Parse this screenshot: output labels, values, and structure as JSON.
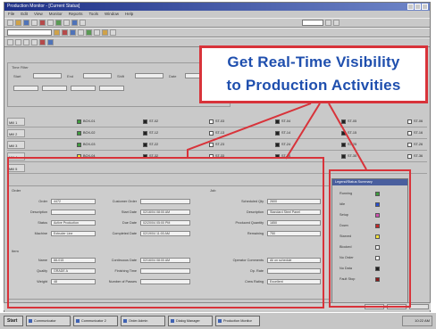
{
  "window": {
    "title": "Production Monitor - [Current Status]",
    "menu": [
      "File",
      "Edit",
      "View",
      "Monitor",
      "Reports",
      "Tools",
      "Window",
      "Help"
    ]
  },
  "filters": {
    "group_label": "Time Filter",
    "fields": [
      {
        "label": "Start",
        "value": ""
      },
      {
        "label": "End",
        "value": ""
      },
      {
        "label": "Shift",
        "value": ""
      },
      {
        "label": "Date",
        "value": ""
      }
    ]
  },
  "grid": {
    "rows": [
      {
        "label": "Mill 1",
        "cells": [
          {
            "marker": "green",
            "text": "BOX-01"
          },
          {
            "marker": "black",
            "text": "ST-02"
          },
          {
            "marker": "plus",
            "text": "ST-03"
          },
          {
            "marker": "black",
            "text": "ST-04"
          },
          {
            "marker": "black",
            "text": "ST-05"
          },
          {
            "marker": "plus",
            "text": "ST-06"
          }
        ]
      },
      {
        "label": "Mill 2",
        "cells": [
          {
            "marker": "green",
            "text": "BOX-02"
          },
          {
            "marker": "black",
            "text": "ST-12"
          },
          {
            "marker": "plus",
            "text": "ST-13"
          },
          {
            "marker": "black",
            "text": "ST-14"
          },
          {
            "marker": "black",
            "text": "ST-15"
          },
          {
            "marker": "plus",
            "text": "ST-16"
          }
        ]
      },
      {
        "label": "Mill 3",
        "cells": [
          {
            "marker": "green",
            "text": "BOX-03"
          },
          {
            "marker": "black",
            "text": "ST-22"
          },
          {
            "marker": "plus",
            "text": "ST-23"
          },
          {
            "marker": "black",
            "text": "ST-24"
          },
          {
            "marker": "black",
            "text": "ST-25"
          },
          {
            "marker": "plus",
            "text": "ST-26"
          }
        ]
      },
      {
        "label": "Mill 4",
        "cells": [
          {
            "marker": "yellow",
            "text": "BOX-04"
          },
          {
            "marker": "black",
            "text": "ST-32"
          },
          {
            "marker": "plus",
            "text": "ST-33"
          },
          {
            "marker": "black",
            "text": "ST-34"
          },
          {
            "marker": "black",
            "text": "ST-35"
          },
          {
            "marker": "plus",
            "text": "ST-36"
          }
        ]
      },
      {
        "label": "Mill 5",
        "cells": []
      }
    ]
  },
  "detail": {
    "section_left": "Order",
    "section_right": "Job",
    "section_bottom": "Item",
    "left_fields": [
      {
        "label": "Order",
        "value": "4472"
      },
      {
        "label": "Description",
        "value": ""
      },
      {
        "label": "Status",
        "value": "Active Production"
      },
      {
        "label": "Machine",
        "value": "Extruder Line"
      }
    ],
    "mid_fields": [
      {
        "label": "Customer Order",
        "value": ""
      },
      {
        "label": "Start Date",
        "value": "02/16/04 08:00 AM"
      },
      {
        "label": "Due Date",
        "value": "02/20/04 05:00 PM"
      },
      {
        "label": "Completed Date",
        "value": "02/19/04 11:00 AM"
      }
    ],
    "right_fields": [
      {
        "label": "Scheduled Qty",
        "value": "2600"
      },
      {
        "label": "Description",
        "value": "Standard Steel Panel"
      },
      {
        "label": "Produced Quantity",
        "value": "1850"
      },
      {
        "label": "Remaining",
        "value": "750"
      }
    ],
    "bottom_left": [
      {
        "label": "Name",
        "value": "88-015"
      },
      {
        "label": "Quality",
        "value": "GRADE A"
      },
      {
        "label": "Weight",
        "value": "48"
      }
    ],
    "bottom_mid": [
      {
        "label": "Continuous Date",
        "value": "02/16/04 08:00 AM"
      },
      {
        "label": "Finishing Time",
        "value": ""
      },
      {
        "label": "Number of Passes",
        "value": ""
      }
    ],
    "bottom_right": [
      {
        "label": "Operator Comments",
        "value": "All on schedule"
      },
      {
        "label": "Op. Rate",
        "value": ""
      },
      {
        "label": "Crew Rating",
        "value": "Excellent"
      }
    ]
  },
  "legend": {
    "title": "Legend/Status Summary",
    "items": [
      {
        "label": "Running",
        "color": "#3e9b3e"
      },
      {
        "label": "Idle",
        "color": "#2a4fd0"
      },
      {
        "label": "Setup",
        "color": "#d04fb0"
      },
      {
        "label": "Down",
        "color": "#c62828"
      },
      {
        "label": "Starved",
        "color": "#f3e23a"
      },
      {
        "label": "Blocked",
        "color": "#eeeeee"
      },
      {
        "label": "No Order",
        "color": "#ffffff"
      },
      {
        "label": "No Data",
        "color": "#222222"
      },
      {
        "label": "Fault Stop",
        "color": "#8b1a1a"
      }
    ]
  },
  "callout": {
    "line1": "Get Real-Time Visibility",
    "line2": "to Production Activities"
  },
  "taskbar": {
    "start_label": "Start",
    "items": [
      "Communicator",
      "Communicator 2",
      "Order Admin",
      "Dialog Manager",
      "Production Monitor"
    ],
    "clock": "10:22 AM"
  }
}
